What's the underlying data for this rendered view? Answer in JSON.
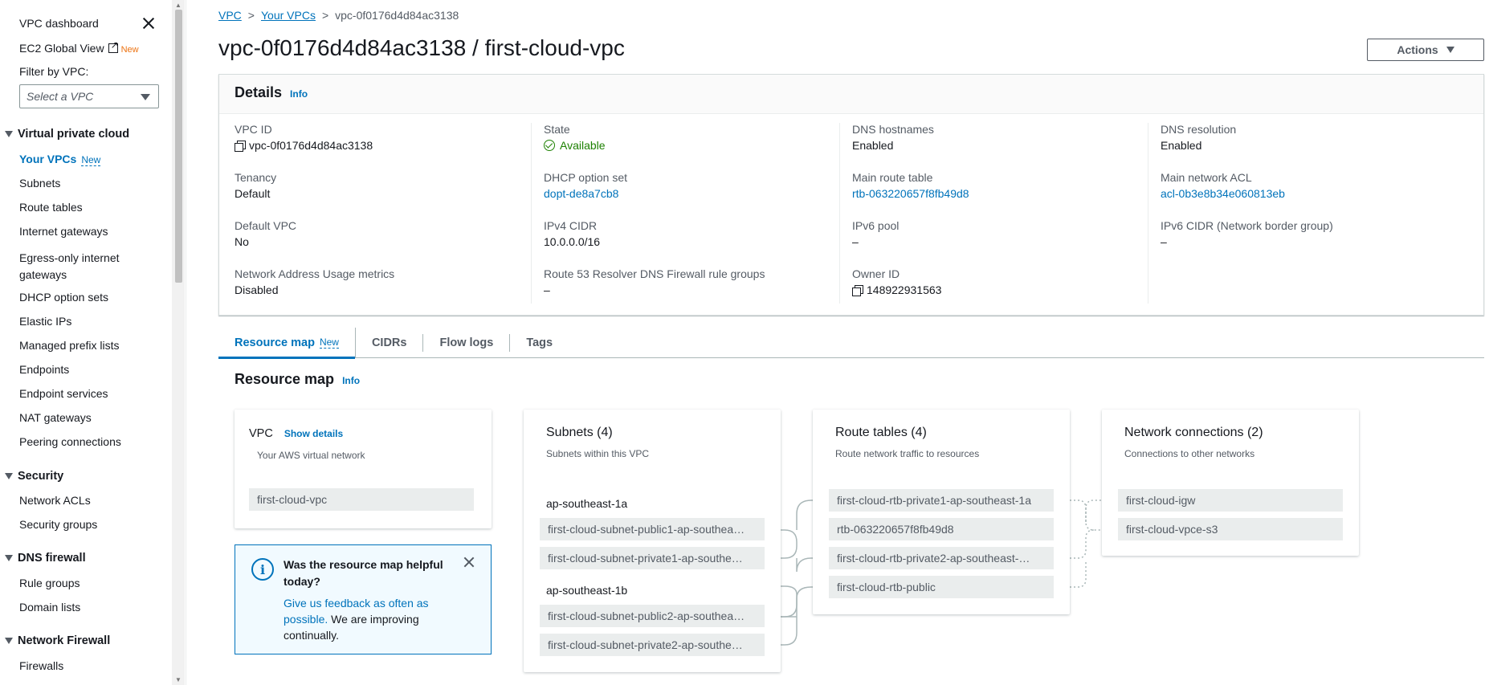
{
  "sidebar": {
    "dashboard": "VPC dashboard",
    "global_view": "EC2 Global View",
    "global_view_badge": "New",
    "filter_label": "Filter by VPC:",
    "filter_placeholder": "Select a VPC",
    "sections": [
      {
        "title": "Virtual private cloud",
        "items": [
          {
            "label": "Your VPCs",
            "badge": "New"
          },
          {
            "label": "Subnets"
          },
          {
            "label": "Route tables"
          },
          {
            "label": "Internet gateways"
          },
          {
            "label": "Egress-only internet gateways"
          },
          {
            "label": "DHCP option sets"
          },
          {
            "label": "Elastic IPs"
          },
          {
            "label": "Managed prefix lists"
          },
          {
            "label": "Endpoints"
          },
          {
            "label": "Endpoint services"
          },
          {
            "label": "NAT gateways"
          },
          {
            "label": "Peering connections"
          }
        ]
      },
      {
        "title": "Security",
        "items": [
          {
            "label": "Network ACLs"
          },
          {
            "label": "Security groups"
          }
        ]
      },
      {
        "title": "DNS firewall",
        "items": [
          {
            "label": "Rule groups"
          },
          {
            "label": "Domain lists"
          }
        ]
      },
      {
        "title": "Network Firewall",
        "items": [
          {
            "label": "Firewalls"
          }
        ]
      }
    ]
  },
  "breadcrumb": {
    "root": "VPC",
    "parent": "Your VPCs",
    "current": "vpc-0f0176d4d84ac3138"
  },
  "page_title": "vpc-0f0176d4d84ac3138 / first-cloud-vpc",
  "actions_label": "Actions",
  "details": {
    "title": "Details",
    "info": "Info",
    "fields": {
      "vpc_id": {
        "k": "VPC ID",
        "v": "vpc-0f0176d4d84ac3138"
      },
      "state": {
        "k": "State",
        "v": "Available"
      },
      "dns_hostnames": {
        "k": "DNS hostnames",
        "v": "Enabled"
      },
      "dns_resolution": {
        "k": "DNS resolution",
        "v": "Enabled"
      },
      "tenancy": {
        "k": "Tenancy",
        "v": "Default"
      },
      "dhcp": {
        "k": "DHCP option set",
        "v": "dopt-de8a7cb8"
      },
      "main_rt": {
        "k": "Main route table",
        "v": "rtb-063220657f8fb49d8"
      },
      "main_acl": {
        "k": "Main network ACL",
        "v": "acl-0b3e8b34e060813eb"
      },
      "default_vpc": {
        "k": "Default VPC",
        "v": "No"
      },
      "ipv4": {
        "k": "IPv4 CIDR",
        "v": "10.0.0.0/16"
      },
      "ipv6_pool": {
        "k": "IPv6 pool",
        "v": "–"
      },
      "ipv6_cidr": {
        "k": "IPv6 CIDR (Network border group)",
        "v": "–"
      },
      "nau": {
        "k": "Network Address Usage metrics",
        "v": "Disabled"
      },
      "r53": {
        "k": "Route 53 Resolver DNS Firewall rule groups",
        "v": "–"
      },
      "owner": {
        "k": "Owner ID",
        "v": "148922931563"
      }
    }
  },
  "tabs": {
    "resource_map": "Resource map",
    "resource_map_badge": "New",
    "cidrs": "CIDRs",
    "flow_logs": "Flow logs",
    "tags": "Tags"
  },
  "resource_map": {
    "title": "Resource map",
    "info": "Info",
    "vpc_card": {
      "title": "VPC",
      "show_details": "Show details",
      "subtitle": "Your AWS virtual network",
      "item": "first-cloud-vpc"
    },
    "subnets_card": {
      "title": "Subnets (4)",
      "subtitle": "Subnets within this VPC",
      "az1": "ap-southeast-1a",
      "az2": "ap-southeast-1b",
      "items": [
        "first-cloud-subnet-public1-ap-southea…",
        "first-cloud-subnet-private1-ap-southe…",
        "first-cloud-subnet-public2-ap-southea…",
        "first-cloud-subnet-private2-ap-southe…"
      ]
    },
    "rt_card": {
      "title": "Route tables (4)",
      "subtitle": "Route network traffic to resources",
      "items": [
        "first-cloud-rtb-private1-ap-southeast-1a",
        "rtb-063220657f8fb49d8",
        "first-cloud-rtb-private2-ap-southeast-…",
        "first-cloud-rtb-public"
      ]
    },
    "nc_card": {
      "title": "Network connections (2)",
      "subtitle": "Connections to other networks",
      "items": [
        "first-cloud-igw",
        "first-cloud-vpce-s3"
      ]
    }
  },
  "feedback": {
    "title": "Was the resource map helpful today?",
    "link": "Give us feedback as often as possible.",
    "rest": " We are improving continually."
  }
}
